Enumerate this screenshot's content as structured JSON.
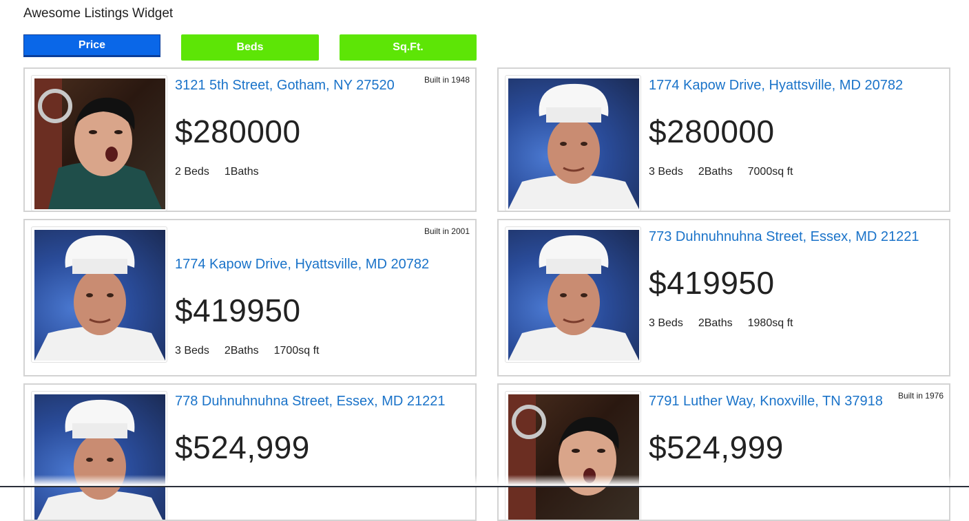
{
  "widget": {
    "title": "Awesome Listings Widget"
  },
  "sort_buttons": {
    "price": "Price",
    "beds": "Beds",
    "sqft": "Sq.Ft."
  },
  "colors": {
    "price_button": "#0a67e8",
    "beds_button": "#5de506",
    "sqft_button": "#5de506",
    "link": "#1a73c9"
  },
  "listings": [
    {
      "address": "3121 5th Street, Gotham, NY 27520",
      "price": "$280000",
      "beds": "2 Beds",
      "baths": "1Baths",
      "sqft": "",
      "built": "Built in 1948",
      "photo": "man-with-open-mouth-photo"
    },
    {
      "address": "1774 Kapow Drive, Hyattsville, MD 20782",
      "price": "$280000",
      "beds": "3 Beds",
      "baths": "2Baths",
      "sqft": "7000sq ft",
      "built": "",
      "photo": "chef-hat-man-photo"
    },
    {
      "address": "1774 Kapow Drive, Hyattsville, MD 20782",
      "price": "$419950",
      "beds": "3 Beds",
      "baths": "2Baths",
      "sqft": "1700sq ft",
      "built": "Built in 2001",
      "photo": "chef-hat-man-photo"
    },
    {
      "address": "773 Duhnuhnuhna Street, Essex, MD 21221",
      "price": "$419950",
      "beds": "3 Beds",
      "baths": "2Baths",
      "sqft": "1980sq ft",
      "built": "",
      "photo": "chef-hat-man-photo"
    },
    {
      "address": "778 Duhnuhnuhna Street, Essex, MD 21221",
      "price": "$524,999",
      "beds": "",
      "baths": "",
      "sqft": "",
      "built": "",
      "photo": "chef-hat-man-photo"
    },
    {
      "address": "7791 Luther Way, Knoxville, TN 37918",
      "price": "$524,999",
      "beds": "",
      "baths": "",
      "sqft": "",
      "built": "Built in 1976",
      "photo": "man-with-open-mouth-photo"
    }
  ]
}
